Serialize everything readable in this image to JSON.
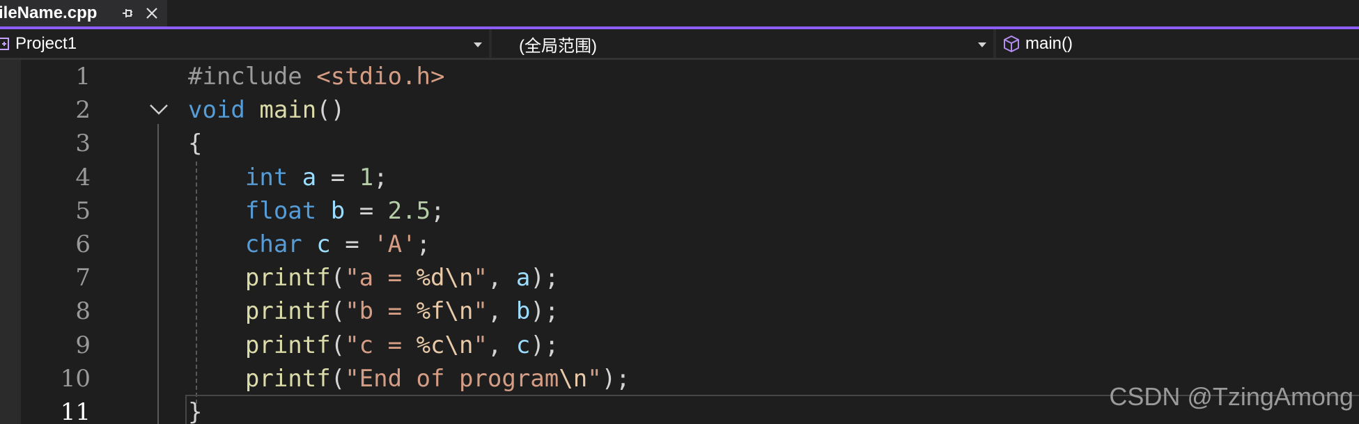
{
  "tab": {
    "title": "ileName.cpp"
  },
  "nav": {
    "project": "Project1",
    "scope": "(全局范围)",
    "member": "main()"
  },
  "editor": {
    "line_numbers": [
      "1",
      "2",
      "3",
      "4",
      "5",
      "6",
      "7",
      "8",
      "9",
      "10",
      "11"
    ],
    "current_line": 11,
    "lines": [
      [
        {
          "t": "#include ",
          "c": "pre"
        },
        {
          "t": "<stdio.h>",
          "c": "inc"
        }
      ],
      [
        {
          "t": "void",
          "c": "kw"
        },
        {
          "t": " ",
          "c": "pun"
        },
        {
          "t": "main",
          "c": "fn"
        },
        {
          "t": "()",
          "c": "pun"
        }
      ],
      [
        {
          "t": "{",
          "c": "pun"
        }
      ],
      [
        {
          "t": "    ",
          "c": "pun"
        },
        {
          "t": "int",
          "c": "kw"
        },
        {
          "t": " ",
          "c": "pun"
        },
        {
          "t": "a",
          "c": "var"
        },
        {
          "t": " = ",
          "c": "pun"
        },
        {
          "t": "1",
          "c": "num"
        },
        {
          "t": ";",
          "c": "pun"
        }
      ],
      [
        {
          "t": "    ",
          "c": "pun"
        },
        {
          "t": "float",
          "c": "kw"
        },
        {
          "t": " ",
          "c": "pun"
        },
        {
          "t": "b",
          "c": "var"
        },
        {
          "t": " = ",
          "c": "pun"
        },
        {
          "t": "2.5",
          "c": "num"
        },
        {
          "t": ";",
          "c": "pun"
        }
      ],
      [
        {
          "t": "    ",
          "c": "pun"
        },
        {
          "t": "char",
          "c": "kw"
        },
        {
          "t": " ",
          "c": "pun"
        },
        {
          "t": "c",
          "c": "var"
        },
        {
          "t": " = ",
          "c": "pun"
        },
        {
          "t": "'A'",
          "c": "str"
        },
        {
          "t": ";",
          "c": "pun"
        }
      ],
      [
        {
          "t": "    ",
          "c": "pun"
        },
        {
          "t": "printf",
          "c": "fn"
        },
        {
          "t": "(",
          "c": "pun"
        },
        {
          "t": "\"a = ",
          "c": "str"
        },
        {
          "t": "%d",
          "c": "esc"
        },
        {
          "t": "\\n",
          "c": "esc"
        },
        {
          "t": "\"",
          "c": "str"
        },
        {
          "t": ", ",
          "c": "pun"
        },
        {
          "t": "a",
          "c": "var"
        },
        {
          "t": ");",
          "c": "pun"
        }
      ],
      [
        {
          "t": "    ",
          "c": "pun"
        },
        {
          "t": "printf",
          "c": "fn"
        },
        {
          "t": "(",
          "c": "pun"
        },
        {
          "t": "\"b = ",
          "c": "str"
        },
        {
          "t": "%f",
          "c": "esc"
        },
        {
          "t": "\\n",
          "c": "esc"
        },
        {
          "t": "\"",
          "c": "str"
        },
        {
          "t": ", ",
          "c": "pun"
        },
        {
          "t": "b",
          "c": "var"
        },
        {
          "t": ");",
          "c": "pun"
        }
      ],
      [
        {
          "t": "    ",
          "c": "pun"
        },
        {
          "t": "printf",
          "c": "fn"
        },
        {
          "t": "(",
          "c": "pun"
        },
        {
          "t": "\"c = ",
          "c": "str"
        },
        {
          "t": "%c",
          "c": "esc"
        },
        {
          "t": "\\n",
          "c": "esc"
        },
        {
          "t": "\"",
          "c": "str"
        },
        {
          "t": ", ",
          "c": "pun"
        },
        {
          "t": "c",
          "c": "var"
        },
        {
          "t": ");",
          "c": "pun"
        }
      ],
      [
        {
          "t": "    ",
          "c": "pun"
        },
        {
          "t": "printf",
          "c": "fn"
        },
        {
          "t": "(",
          "c": "pun"
        },
        {
          "t": "\"End of program",
          "c": "str"
        },
        {
          "t": "\\n",
          "c": "esc"
        },
        {
          "t": "\"",
          "c": "str"
        },
        {
          "t": ");",
          "c": "pun"
        }
      ],
      [
        {
          "t": "}",
          "c": "pun"
        }
      ]
    ]
  },
  "watermark": "CSDN @TzingAmong",
  "icons": {
    "pin": "pin-icon",
    "close": "close-icon",
    "project": "project-icon",
    "member": "cube-icon",
    "fold": "chevron-down-icon"
  },
  "colors": {
    "accent": "#8b5cf6",
    "keyword": "#569cd6",
    "function": "#dcdcaa",
    "variable": "#9cdcfe",
    "number": "#b5cea8",
    "string": "#d69d85",
    "preprocessor": "#9b9b9b"
  }
}
